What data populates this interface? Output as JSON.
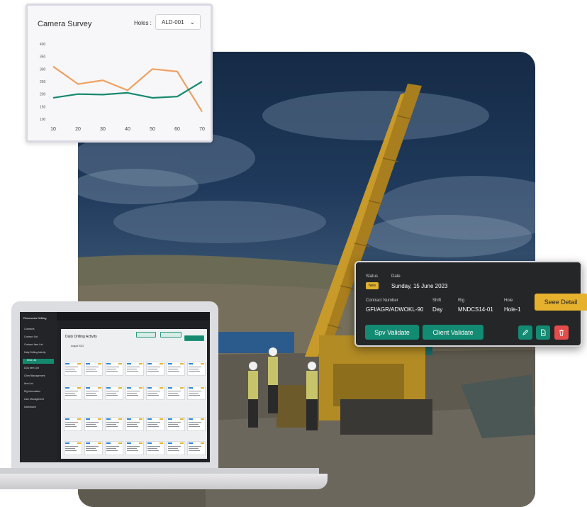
{
  "chart_card": {
    "title": "Camera Survey",
    "holes_label": "Holes :",
    "holes_value": "ALD-001"
  },
  "chart_data": {
    "type": "line",
    "x": [
      10,
      20,
      30,
      40,
      50,
      60,
      70
    ],
    "y_ticks": [
      400,
      350,
      300,
      250,
      200,
      150,
      100
    ],
    "ylim": [
      100,
      400
    ],
    "series": [
      {
        "values": [
          310,
          240,
          255,
          215,
          300,
          290,
          130
        ],
        "color": "#f0a060"
      },
      {
        "values": [
          185,
          200,
          198,
          205,
          185,
          190,
          250
        ],
        "color": "#15896f"
      }
    ]
  },
  "info_card": {
    "status_label": "Status",
    "status_value": "New",
    "date_label": "Date",
    "date_value": "Sunday, 15 June 2023",
    "contract_label": "Contract Number",
    "contract_value": "GFI/AGR/ADWOKL-90",
    "shift_label": "Shift",
    "shift_value": "Day",
    "rig_label": "Rig",
    "rig_value": "MNDCS14-01",
    "hole_label": "Hole",
    "hole_value": "Hole-1",
    "spv_button": "Spv Validate",
    "client_button": "Client Validate",
    "see_detail": "Seee Detail",
    "colors": {
      "accent": "#138a72",
      "badge": "#e2b12d",
      "delete": "#e24c4b"
    },
    "icons": [
      "edit-icon",
      "document-icon",
      "trash-icon"
    ]
  },
  "laptop": {
    "brand": "Resources Drilling",
    "sidebar": [
      "Contracts",
      "Contract List",
      "Contract Item List",
      "Daily Drilling Activity",
      "DDA List",
      "DDA Item List",
      "Client Management",
      "Item List",
      "Rig Information",
      "User Management",
      "Dashboard"
    ],
    "page_title": "Daily Drilling Activity",
    "date": "August 2023"
  }
}
